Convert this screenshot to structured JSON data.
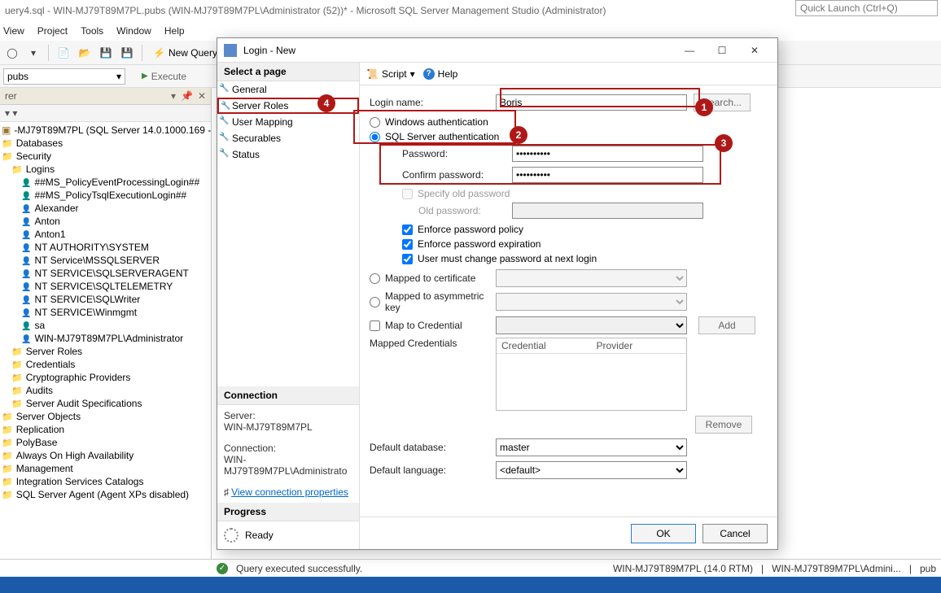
{
  "title": "uery4.sql - WIN-MJ79T89M7PL.pubs (WIN-MJ79T89M7PL\\Administrator (52))* - Microsoft SQL Server Management Studio (Administrator)",
  "quick_launch": "Quick Launch (Ctrl+Q)",
  "menus": [
    "View",
    "Project",
    "Tools",
    "Window",
    "Help"
  ],
  "toolbar": {
    "new_query": "New Query"
  },
  "toolbar2": {
    "db": "pubs",
    "execute": "Execute"
  },
  "explorer": {
    "title": "rer",
    "toolbar": "▾ ▾",
    "root": "-MJ79T89M7PL (SQL Server 14.0.1000.169 - \\",
    "databases": "Databases",
    "security": "Security",
    "logins": "Logins",
    "items": [
      "##MS_PolicyEventProcessingLogin##",
      "##MS_PolicyTsqlExecutionLogin##",
      "Alexander",
      "Anton",
      "Anton1",
      "NT AUTHORITY\\SYSTEM",
      "NT Service\\MSSQLSERVER",
      "NT SERVICE\\SQLSERVERAGENT",
      "NT SERVICE\\SQLTELEMETRY",
      "NT SERVICE\\SQLWriter",
      "NT SERVICE\\Winmgmt",
      "sa",
      "WIN-MJ79T89M7PL\\Administrator"
    ],
    "folders": [
      "Server Roles",
      "Credentials",
      "Cryptographic Providers",
      "Audits",
      "Server Audit Specifications"
    ],
    "root_folders": [
      "Server Objects",
      "Replication",
      "PolyBase",
      "Always On High Availability",
      "Management",
      "Integration Services Catalogs",
      "SQL Server Agent (Agent XPs disabled)"
    ]
  },
  "dialog": {
    "title": "Login - New",
    "pages_hdr": "Select a page",
    "pages": [
      "General",
      "Server Roles",
      "User Mapping",
      "Securables",
      "Status"
    ],
    "script": "Script",
    "help": "Help",
    "conn_hdr": "Connection",
    "server_lbl": "Server:",
    "server_val": "WIN-MJ79T89M7PL",
    "connection_lbl": "Connection:",
    "connection_val": "WIN-MJ79T89M7PL\\Administrato",
    "view_props": "View connection properties",
    "progress_hdr": "Progress",
    "ready": "Ready",
    "form": {
      "login_name_lbl": "Login name:",
      "login_name_val": "Boris",
      "search": "Search...",
      "win_auth": "Windows authentication",
      "sql_auth": "SQL Server authentication",
      "password_lbl": "Password:",
      "password_val": "••••••••••",
      "confirm_lbl": "Confirm password:",
      "confirm_val": "••••••••••",
      "specify_old": "Specify old password",
      "old_pw_lbl": "Old password:",
      "enforce_policy": "Enforce password policy",
      "enforce_exp": "Enforce password expiration",
      "must_change": "User must change password at next login",
      "map_cert": "Mapped to certificate",
      "map_asym": "Mapped to asymmetric key",
      "map_cred": "Map to Credential",
      "add": "Add",
      "mapped_creds": "Mapped Credentials",
      "col_cred": "Credential",
      "col_prov": "Provider",
      "remove": "Remove",
      "def_db_lbl": "Default database:",
      "def_db_val": "master",
      "def_lang_lbl": "Default language:",
      "def_lang_val": "<default>"
    },
    "ok": "OK",
    "cancel": "Cancel"
  },
  "status": {
    "msg": "Query executed successfully.",
    "server": "WIN-MJ79T89M7PL (14.0 RTM)",
    "user": "WIN-MJ79T89M7PL\\Admini...",
    "db": "pub"
  },
  "callouts": {
    "c1": "1",
    "c2": "2",
    "c3": "3",
    "c4": "4"
  }
}
